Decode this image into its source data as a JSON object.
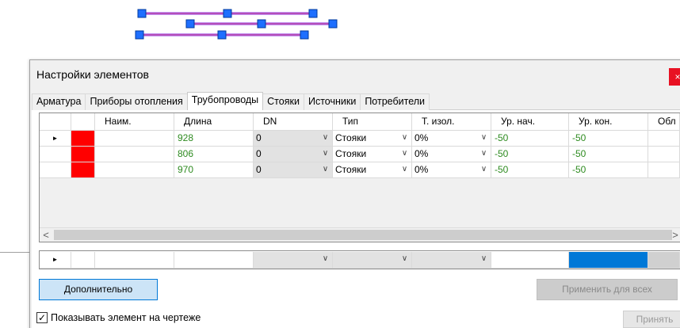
{
  "dialog": {
    "title": "Настройки элементов",
    "close_glyph": "×"
  },
  "tabs": [
    {
      "label": "Арматура",
      "active": false
    },
    {
      "label": "Приборы отопления",
      "active": false
    },
    {
      "label": "Трубопроводы",
      "active": true
    },
    {
      "label": "Стояки",
      "active": false
    },
    {
      "label": "Источники",
      "active": false
    },
    {
      "label": "Потребители",
      "active": false
    }
  ],
  "grid": {
    "columns": [
      "",
      "",
      "Наим.",
      "Длина",
      "DN",
      "Тип",
      "Т. изол.",
      "Ур. нач.",
      "Ур. кон.",
      "Обл"
    ],
    "rows": [
      {
        "marker": "►",
        "name": "",
        "length": "928",
        "dn": "0",
        "type": "Стояки",
        "insulation": "0%",
        "level_start": "-50",
        "level_end": "-50"
      },
      {
        "marker": "",
        "name": "",
        "length": "806",
        "dn": "0",
        "type": "Стояки",
        "insulation": "0%",
        "level_start": "-50",
        "level_end": "-50"
      },
      {
        "marker": "",
        "name": "",
        "length": "970",
        "dn": "0",
        "type": "Стояки",
        "insulation": "0%",
        "level_start": "-50",
        "level_end": "-50"
      }
    ],
    "row_color": "#ff0000",
    "value_color": "#2e8b20",
    "scroll_left": "<",
    "scroll_right": ">"
  },
  "new_row": {
    "marker": "►",
    "highlight_color": "#0078d7"
  },
  "combo_arrow": "∨",
  "buttons": {
    "more": "Дополнительно",
    "apply_all": "Применить для всех",
    "ok": "Принять"
  },
  "show_on_drawing": {
    "label": "Показывать элемент на чертеже",
    "checked": true,
    "check_glyph": "✓"
  }
}
